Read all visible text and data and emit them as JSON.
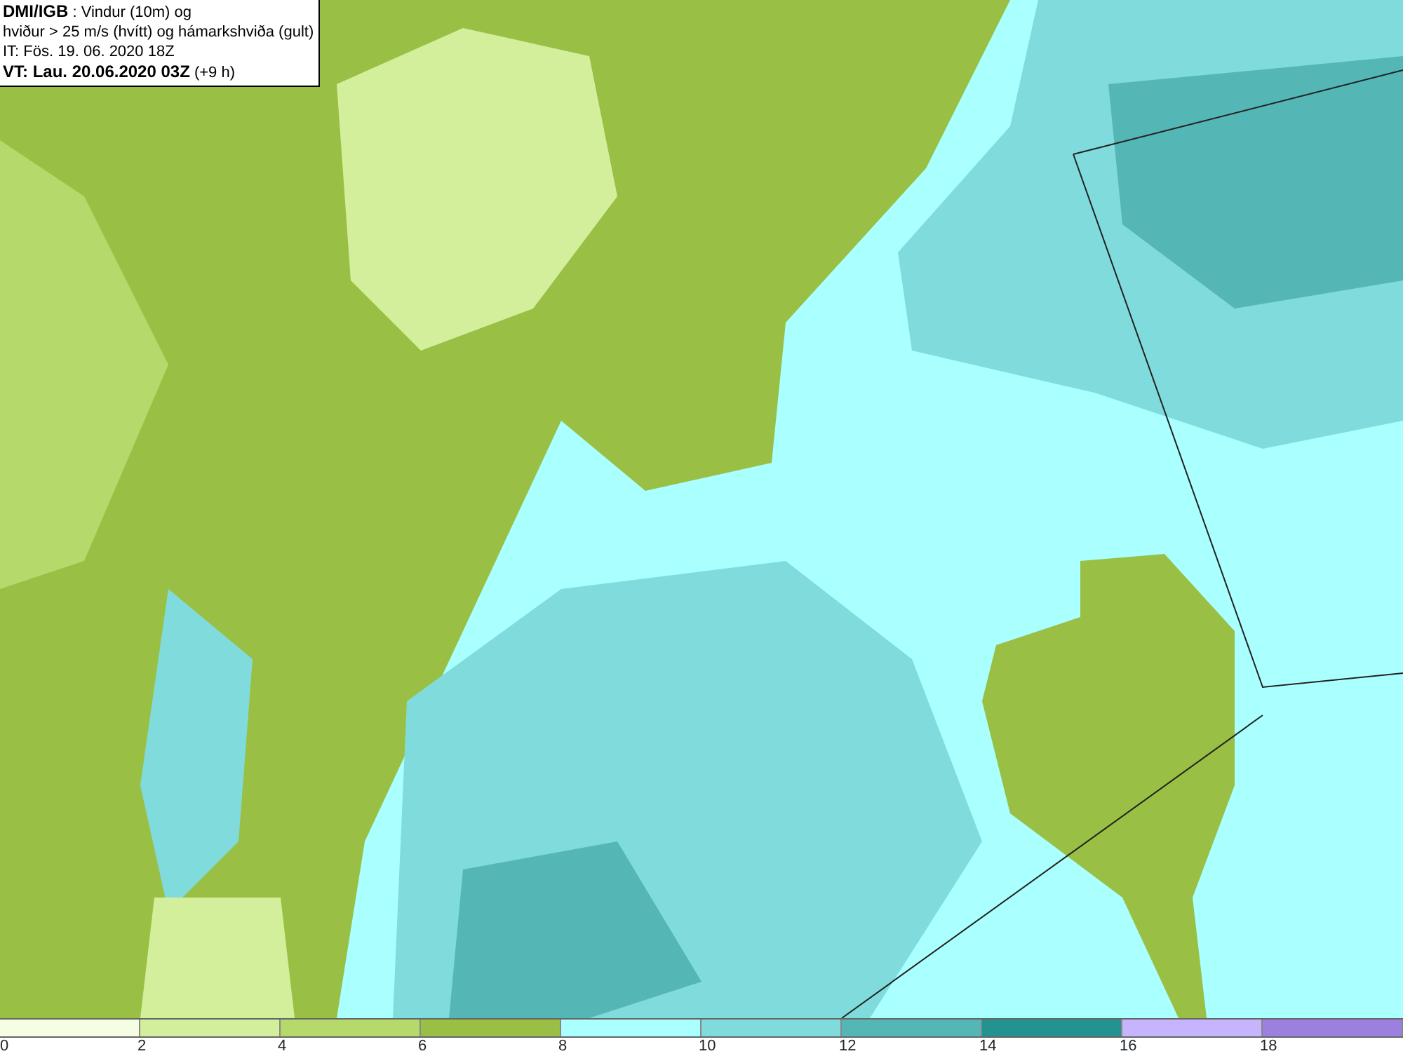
{
  "title_box": {
    "lines": [
      "**DMI/IGB** : Vindur (10m) og",
      "hviður > 25 m/s (hvítt) og hámarkshviða (gult)",
      "IT: Fös. 19. 06. 2020 18Z",
      "**VT: Lau. 20.06.2020 03Z** (+9 h)"
    ]
  },
  "legend": {
    "swatches": [
      {
        "color": "#f5fde2"
      },
      {
        "color": "#d4ef9b"
      },
      {
        "color": "#b5d96a"
      },
      {
        "color": "#99c044"
      },
      {
        "color": "#aaffff"
      },
      {
        "color": "#80dcdc"
      },
      {
        "color": "#55b6b6"
      },
      {
        "color": "#23938f"
      },
      {
        "color": "#c6b4ff"
      },
      {
        "color": "#9b80e0"
      }
    ],
    "labels": [
      "0",
      "2",
      "4",
      "6",
      "8",
      "10",
      "12",
      "14",
      "16",
      "18"
    ]
  }
}
